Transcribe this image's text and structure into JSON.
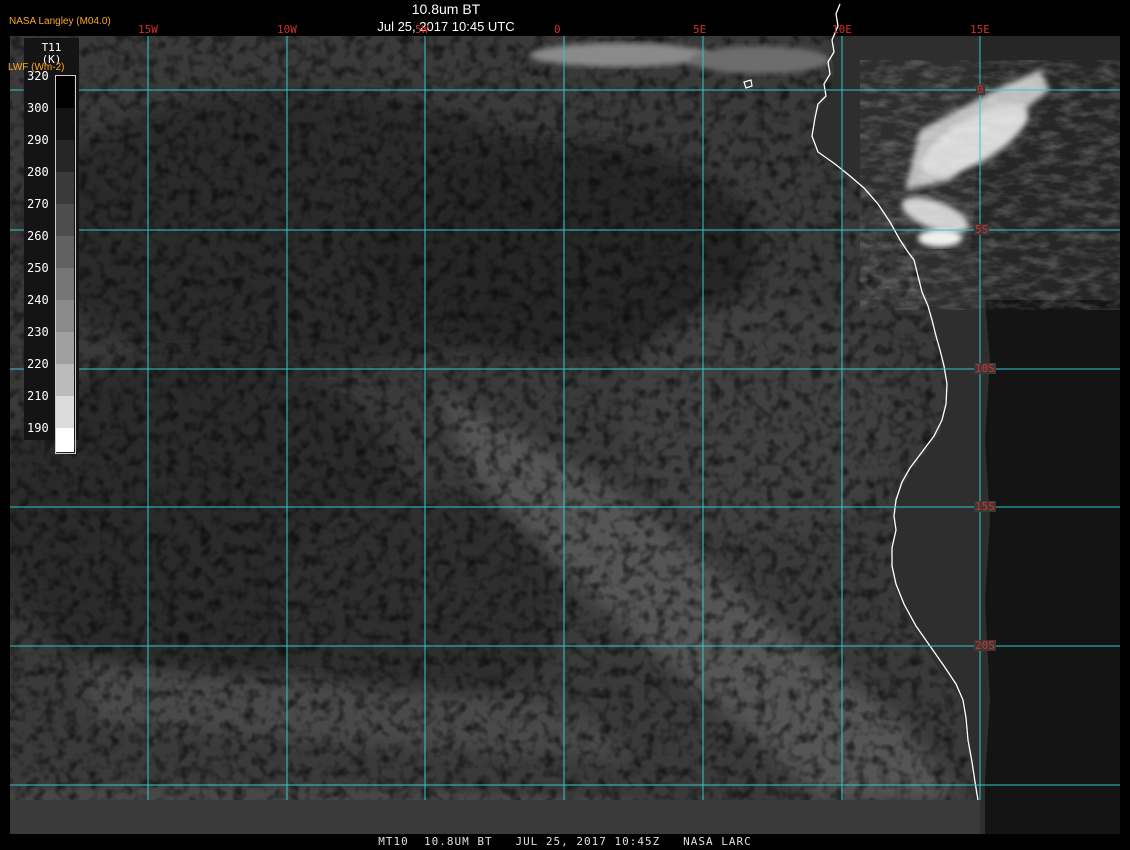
{
  "header": {
    "title": "10.8um BT",
    "subtitle": "Jul 25, 2017 10:45 UTC",
    "credit": "NASA Langley (M04.0)",
    "lwf_label": "LWF (Wm-2)"
  },
  "footer": {
    "caption": "MT10  10.8UM BT   JUL 25, 2017 10:45Z   NASA LARC"
  },
  "colorbar": {
    "title_line1": "T11",
    "title_line2": "(K)",
    "ticks": [
      "320",
      "300",
      "290",
      "280",
      "270",
      "260",
      "250",
      "240",
      "230",
      "220",
      "210",
      "190"
    ]
  },
  "map": {
    "longitude_labels": [
      "15W",
      "10W",
      "5W",
      "0",
      "5E",
      "10E",
      "15E"
    ],
    "latitude_labels": [
      "0",
      "5S",
      "10S",
      "15S",
      "20S"
    ],
    "colors": {
      "gridline": "#33c6cf",
      "coastline": "#ffffff",
      "grid_label": "#d4302a",
      "credit_text": "#ffa726",
      "land": "#131313",
      "ocean_base": "#3a3a3a"
    }
  }
}
